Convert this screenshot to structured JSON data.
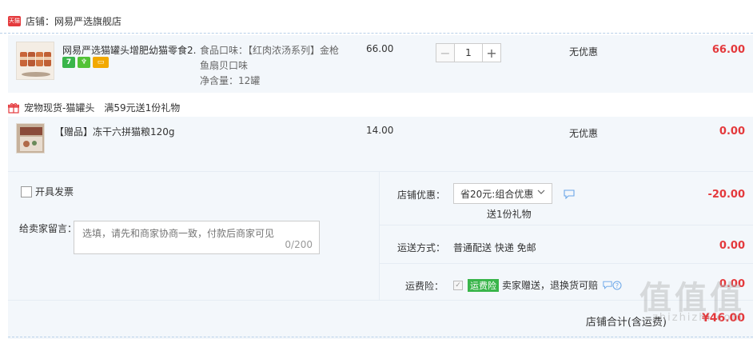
{
  "shop": {
    "badge": "天猫",
    "name": "店铺：网易严选旗舰店"
  },
  "item1": {
    "title": "网易严选猫罐头增肥幼猫零食2...",
    "tags": [
      "7",
      "♆",
      "▭"
    ],
    "spec_lines": [
      "食品口味：【红肉浓汤系列】金枪",
      "鱼扇贝口味",
      "净含量：12罐"
    ],
    "unit_price": "66.00",
    "quantity": "1",
    "qty_minus": "−",
    "qty_plus": "+",
    "discount": "无优惠",
    "subtotal": "66.00"
  },
  "gift_promo": {
    "category": "宠物现货-猫罐头",
    "rule": "满59元送1份礼物"
  },
  "item2": {
    "title": "【赠品】冻干六拼猫粮120g",
    "unit_price": "14.00",
    "discount": "无优惠",
    "subtotal": "0.00"
  },
  "footer": {
    "invoice_label": "开具发票",
    "message_label": "给卖家留言：",
    "message_placeholder": "选填，请先和商家协商一致，付款后商家可见",
    "message_count": "0/200",
    "shop_discount_label": "店铺优惠：",
    "shop_discount_select": "省20元:组合优惠",
    "shop_discount_note": "送1份礼物",
    "shop_discount_amount": "-20.00",
    "shipping_label": "运送方式：",
    "shipping_value": "普通配送 快递 免邮",
    "shipping_amount": "0.00",
    "insurance_label": "运费险：",
    "insurance_badge": "运费险",
    "insurance_desc": "卖家赠送，退换货可赔",
    "insurance_amount": "0.00",
    "total_label": "店铺合计(含运费)",
    "total_amount": "¥46.00"
  },
  "watermark": {
    "main": "值值值",
    "sub": "zhizhizhi.com"
  },
  "colors": {
    "accent_red": "#e4393c",
    "row_bg": "#f3f7fb",
    "tag_green": "#39b54a"
  }
}
